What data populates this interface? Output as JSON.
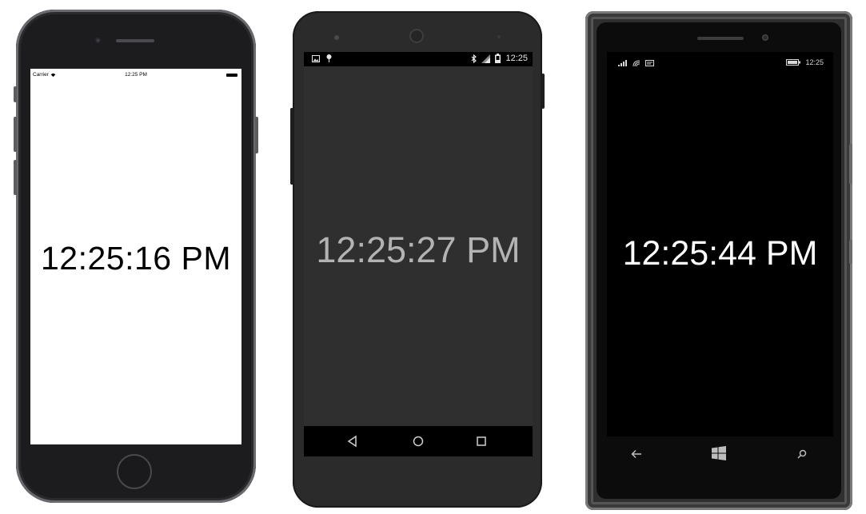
{
  "iphone": {
    "status": {
      "carrier": "Carrier",
      "time": "12:25 PM"
    },
    "clock": "12:25:16 PM",
    "colors": {
      "screen": "#ffffff",
      "text": "#000000"
    }
  },
  "android": {
    "status": {
      "time": "12:25"
    },
    "clock": "12:25:27 PM",
    "nav": [
      "back-icon",
      "home-icon",
      "recents-icon"
    ],
    "colors": {
      "screen": "#2f2f2f",
      "text": "#b3b3b3"
    }
  },
  "windows_phone": {
    "status": {
      "time": "12:25"
    },
    "clock": "12:25:44 PM",
    "nav": [
      "back-arrow-icon",
      "windows-logo-icon",
      "search-icon"
    ],
    "colors": {
      "screen": "#000000",
      "text": "#ffffff"
    }
  }
}
